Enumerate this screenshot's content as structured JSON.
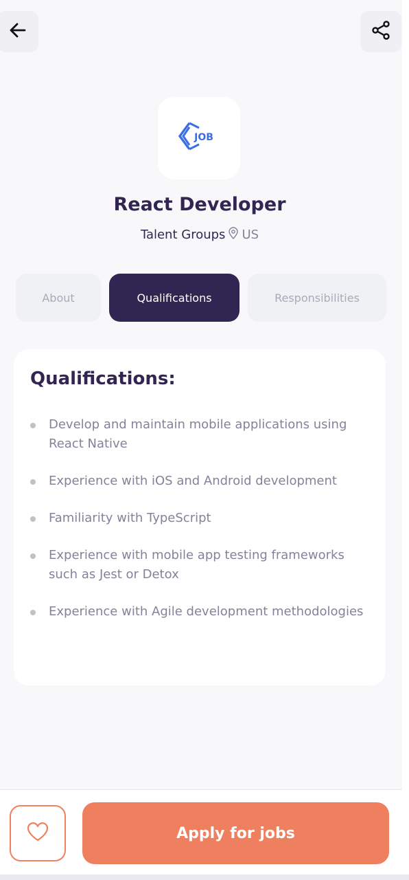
{
  "header": {
    "back_icon": "arrow-left-icon",
    "share_icon": "share-icon"
  },
  "company_logo": {
    "text": "JOB",
    "color": "#3b6fe0"
  },
  "job": {
    "title": "React Developer",
    "company": "Talent Groups",
    "location": "US"
  },
  "tabs": [
    {
      "label": "About",
      "active": false
    },
    {
      "label": "Qualifications",
      "active": true
    },
    {
      "label": "Responsibilities",
      "active": false
    }
  ],
  "qualifications": {
    "heading": "Qualifications:",
    "items": [
      "Develop and maintain mobile applications using React Native",
      "Experience with iOS and Android development",
      "Familiarity with TypeScript",
      "Experience with mobile app testing frameworks such as Jest or Detox",
      "Experience with Agile development methodologies"
    ]
  },
  "footer": {
    "favorite_icon": "heart-icon",
    "apply_label": "Apply for jobs"
  },
  "colors": {
    "primary": "#312651",
    "accent": "#ef805f",
    "muted_text": "#83829a",
    "background": "#f8f8fb"
  }
}
